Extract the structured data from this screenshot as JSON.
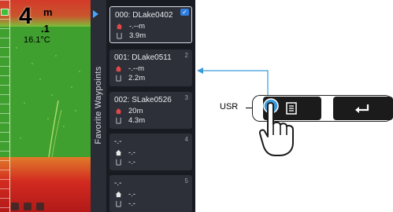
{
  "sonar": {
    "depth_value": "4",
    "depth_unit": "m",
    "depth_fraction": ".1",
    "temperature": "16.1°C",
    "battery_icon": "battery-icon"
  },
  "panel": {
    "tab_label": "Favorite Waypoints",
    "arrow_icon": "triangle-right-icon"
  },
  "waypoints": [
    {
      "title": "000: DLake0402",
      "index": "",
      "home_value": "-.--m",
      "depth_value": "3.9m",
      "selected": true
    },
    {
      "title": "001: DLake0511",
      "index": "2",
      "home_value": "-.--m",
      "depth_value": "2.2m",
      "selected": false
    },
    {
      "title": "002: SLake0526",
      "index": "3",
      "home_value": "20m",
      "depth_value": "4.3m",
      "selected": false
    },
    {
      "title": "-.-",
      "index": "4",
      "home_value": "-.-",
      "depth_value": "-.-",
      "selected": false
    },
    {
      "title": "-.-",
      "index": "5",
      "home_value": "-.-",
      "depth_value": "-.-",
      "selected": false
    }
  ],
  "callout": {
    "usr_label": "USR",
    "menu_button_icon": "menu-list-icon",
    "enter_button_icon": "enter-return-icon",
    "hand_icon": "pointing-hand-icon"
  },
  "colors": {
    "accent_blue": "#4aa3ff",
    "arrow_blue": "#3a9ad9",
    "sonar_green": "#3f9f2f",
    "sonar_red": "#d22a20"
  }
}
